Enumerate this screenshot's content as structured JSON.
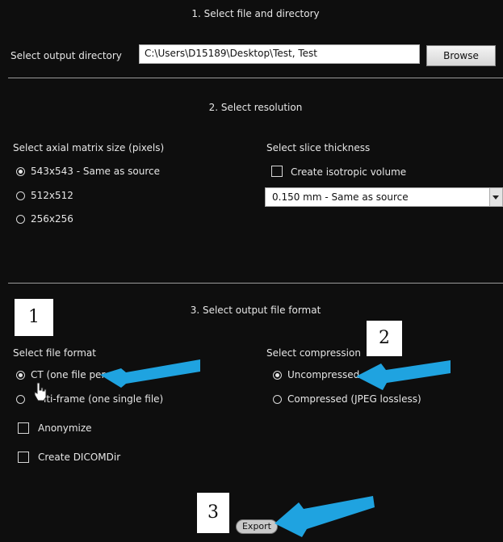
{
  "section1": {
    "heading": "1. Select file and directory",
    "output_dir_label": "Select output directory",
    "output_dir_value": "C:\\Users\\D15189\\Desktop\\Test, Test",
    "browse_label": "Browse"
  },
  "section2": {
    "heading": "2. Select resolution",
    "matrix_label": "Select axial matrix size (pixels)",
    "matrix_options": [
      "543x543 - Same as source",
      "512x512",
      "256x256"
    ],
    "matrix_selected": "543x543 - Same as source",
    "thickness_label": "Select slice thickness",
    "isotropic_label": "Create isotropic volume",
    "isotropic_checked": false,
    "thickness_value": "0.150 mm - Same as source"
  },
  "section3": {
    "heading": "3. Select output file format",
    "format_label": "Select file format",
    "format_options": [
      "CT (one file per sli",
      "lti-frame (one single file)"
    ],
    "format_selected": "CT (one file per sli",
    "compression_label": "Select compression",
    "compression_options": [
      "Uncompressed",
      "Compressed (JPEG lossless)"
    ],
    "compression_selected": "Uncompressed",
    "anonymize_label": "Anonymize",
    "anonymize_checked": false,
    "dicomdir_label": "Create DICOMDir",
    "dicomdir_checked": false,
    "export_label": "Export"
  },
  "annotations": {
    "step1": "1",
    "step2": "2",
    "step3": "3",
    "arrow_color": "#1fa3e0"
  }
}
